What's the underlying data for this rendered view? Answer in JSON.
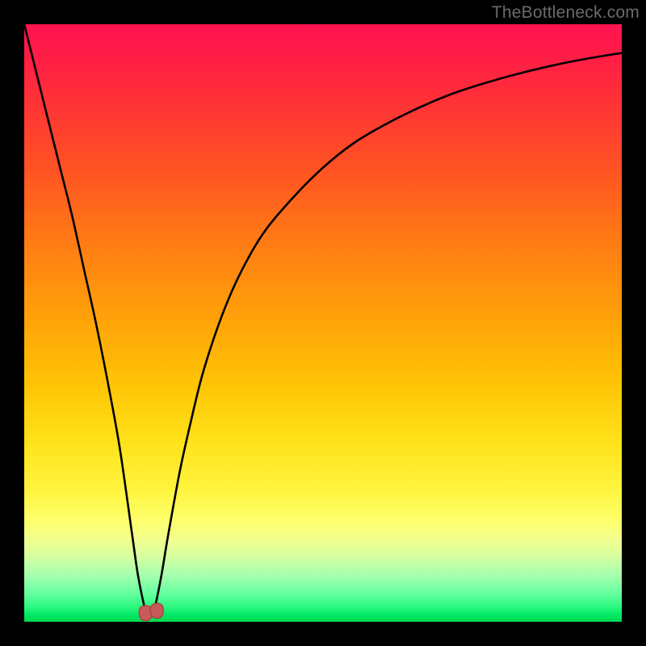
{
  "watermark": {
    "text": "TheBottleneck.com"
  },
  "colors": {
    "frame": "#000000",
    "curve_stroke": "#000000",
    "marker_fill": "#c85a5a",
    "marker_stroke": "#ad4545",
    "gradient_stops": [
      "#ff1450",
      "#ff1e44",
      "#ff3535",
      "#ff5522",
      "#ff7a15",
      "#ff9e0a",
      "#ffc305",
      "#ffe21a",
      "#fff43f",
      "#feff6a",
      "#f3ff8c",
      "#d7ffa0",
      "#a8ffac",
      "#6cffa4",
      "#2bf87f",
      "#00e763",
      "#00d84f"
    ]
  },
  "chart_data": {
    "type": "line",
    "title": "",
    "xlabel": "",
    "ylabel": "",
    "xlim": [
      0,
      100
    ],
    "ylim": [
      0,
      100
    ],
    "grid": false,
    "series": [
      {
        "name": "bottleneck-curve",
        "x": [
          0,
          2,
          4,
          6,
          8,
          10,
          12,
          14,
          16,
          18,
          19,
          20,
          20.5,
          21,
          21.5,
          22,
          23,
          24,
          26,
          28,
          30,
          33,
          36,
          40,
          45,
          50,
          55,
          60,
          66,
          72,
          80,
          88,
          94,
          100
        ],
        "y": [
          100,
          92,
          84,
          76,
          68,
          59,
          50,
          40,
          29,
          15,
          8,
          3,
          1.5,
          1.3,
          1.5,
          3,
          8,
          14,
          25,
          34,
          42,
          51,
          58,
          65,
          71,
          76,
          80,
          83,
          86,
          88.5,
          91,
          93,
          94.2,
          95.2
        ]
      }
    ],
    "annotations": [
      {
        "name": "min-marker-left",
        "shape": "U-left",
        "x": 20.3,
        "y": 1.6
      },
      {
        "name": "min-marker-right",
        "shape": "U-right",
        "x": 22.2,
        "y": 2.0
      }
    ]
  }
}
